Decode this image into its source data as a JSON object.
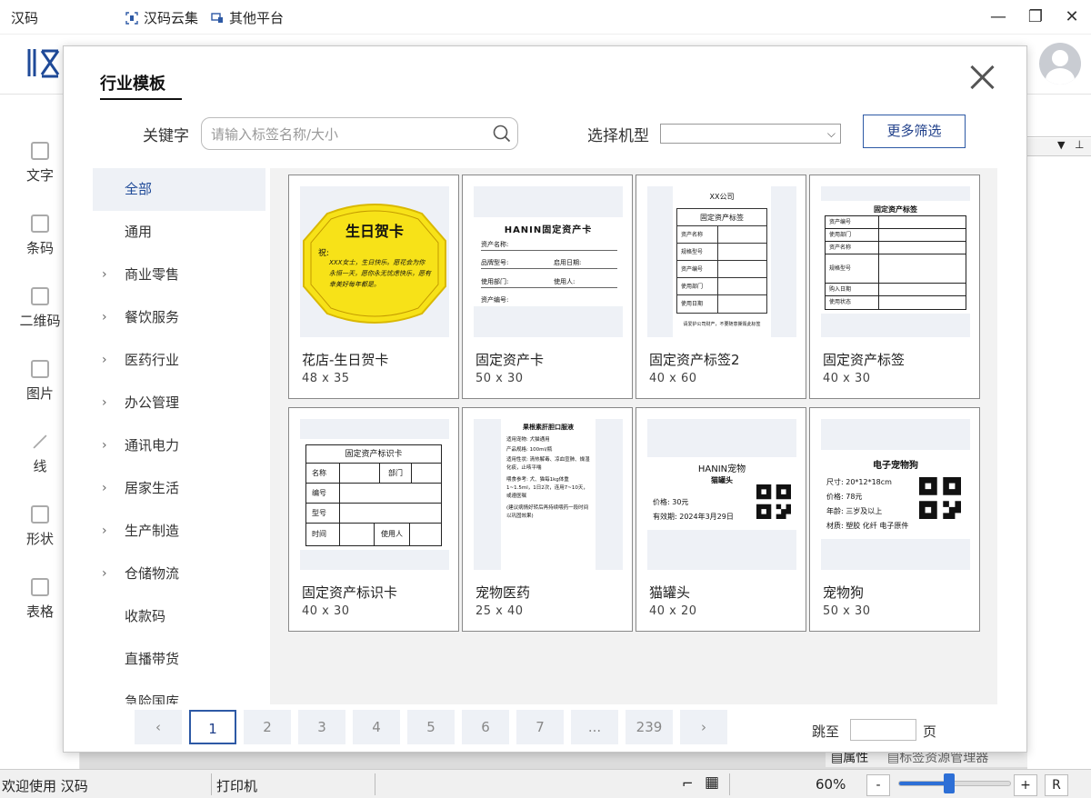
{
  "titlebar": {
    "title": "汉码",
    "links": [
      "汉码云集",
      "其他平台"
    ]
  },
  "toolbar_items": [
    {
      "label": "文字",
      "icon": "text-icon"
    },
    {
      "label": "条码",
      "icon": "barcode-icon"
    },
    {
      "label": "二维码",
      "icon": "qrcode-icon"
    },
    {
      "label": "图片",
      "icon": "image-icon"
    },
    {
      "label": "线",
      "icon": "line-icon"
    },
    {
      "label": "形状",
      "icon": "shape-icon"
    },
    {
      "label": "表格",
      "icon": "table-icon"
    }
  ],
  "modal": {
    "title": "行业模板",
    "keyword_label": "关键字",
    "search_placeholder": "请输入标签名称/大小",
    "model_label": "选择机型",
    "model_value": "",
    "more_filter": "更多筛选",
    "categories": [
      {
        "label": "全部",
        "expandable": false,
        "active": true
      },
      {
        "label": "通用",
        "expandable": false
      },
      {
        "label": "商业零售",
        "expandable": true
      },
      {
        "label": "餐饮服务",
        "expandable": true
      },
      {
        "label": "医药行业",
        "expandable": true
      },
      {
        "label": "办公管理",
        "expandable": true
      },
      {
        "label": "通讯电力",
        "expandable": true
      },
      {
        "label": "居家生活",
        "expandable": true
      },
      {
        "label": "生产制造",
        "expandable": true
      },
      {
        "label": "仓储物流",
        "expandable": true
      },
      {
        "label": "收款码",
        "expandable": false
      },
      {
        "label": "直播带货",
        "expandable": false
      },
      {
        "label": "急险国库",
        "expandable": false
      }
    ],
    "templates": [
      {
        "name": "花店-生日贺卡",
        "size": "48 x 35"
      },
      {
        "name": "固定资产卡",
        "size": "50 x 30"
      },
      {
        "name": "固定资产标签2",
        "size": "40 x 60"
      },
      {
        "name": "固定资产标签",
        "size": "40 x 30"
      },
      {
        "name": "固定资产标识卡",
        "size": "40 x 30"
      },
      {
        "name": "宠物医药",
        "size": "25 x 40"
      },
      {
        "name": "猫罐头",
        "size": "40 x 20"
      },
      {
        "name": "宠物狗",
        "size": "50 x 30"
      }
    ],
    "thumbs": {
      "birthday": {
        "title": "生日贺卡",
        "greet": "祝:",
        "body": "XXX女士，生日快乐。愿花会为你永恒一天，愿你永无忧虑快乐，愿有幸美好每年都是。"
      },
      "asset_card": {
        "title": "HANIN固定资产卡",
        "rows": [
          "资产名称:",
          "品牌型号:",
          "启用日期:",
          "使用部门:",
          "使用人:",
          "资产编号:"
        ]
      },
      "asset2": {
        "company": "XX公司",
        "title": "固定资产标签",
        "rows": [
          "资产名称",
          "规格型号",
          "资产编号",
          "使用部门",
          "使用日期"
        ],
        "footer": "请爱护公司财产，不要随意撕毁此标签"
      },
      "asset3": {
        "title": "固定资产标签",
        "rows": [
          "资产编号",
          "使用部门",
          "资产名称",
          "规格型号",
          "购入日期",
          "使用状态"
        ]
      },
      "asset_id": {
        "title": "固定资产标识卡",
        "name": "名称",
        "dept": "部门",
        "code": "编号",
        "model": "型号",
        "time": "时间",
        "user": "使用人"
      },
      "pet_med": {
        "title": "果根素肝胆口服液",
        "lines": [
          "适用宠物: 犬猫通用",
          "产品规格: 100ml/瓶",
          "适用性状: 清热解毒、凉血宣肺、燥湿化痰，止咳平喘",
          "喂食参考: 犬、猫每1kg体重1~1.5ml，1日2次，连用7~10天，或遵医嘱",
          "(建议病情好转后再持续喂药一段时间以巩固效果)"
        ]
      },
      "cat_can": {
        "title": "HANIN宠物",
        "subtitle": "猫罐头",
        "price": "价格: 30元",
        "expiry": "有效期: 2024年3月29日"
      },
      "dog": {
        "title": "电子宠物狗",
        "lines": [
          "尺寸: 20*12*18cm",
          "价格: 78元",
          "年龄: 三岁及以上",
          "材质: 塑胶 化纤 电子原件"
        ]
      }
    },
    "pager": {
      "pages": [
        "1",
        "2",
        "3",
        "4",
        "5",
        "6",
        "7",
        "...",
        "239"
      ],
      "current": "1",
      "jump_label": "跳至",
      "jump_unit": "页"
    }
  },
  "right_tabs": [
    "属性",
    "标签资源管理器"
  ],
  "statusbar": {
    "welcome": "欢迎使用 汉码",
    "printer": "打印机",
    "zoom": "60%",
    "minus": "-",
    "plus": "+",
    "reset": "R",
    "zoom_level": 0.45
  }
}
